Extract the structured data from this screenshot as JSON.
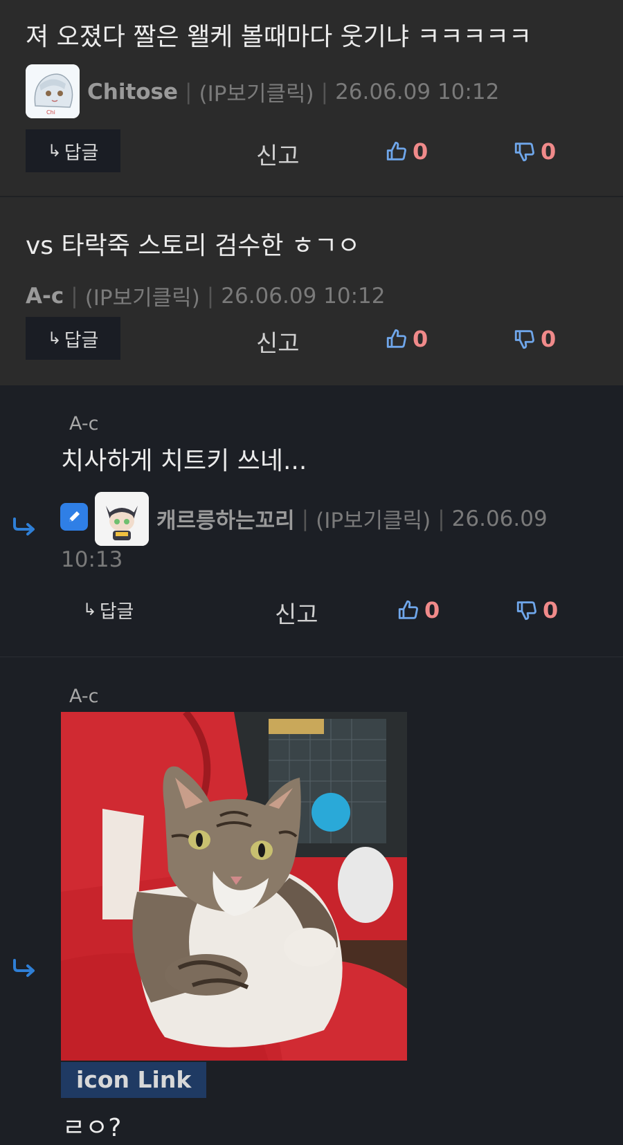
{
  "comments": [
    {
      "text": "져 오졌다 짤은 왤케 볼때마다 웃기냐 ㅋㅋㅋㅋㅋ",
      "author": "Chitose",
      "ip": "(IP보기클릭)",
      "date": "26.06.09 10:12",
      "reply_label": "답글",
      "report_label": "신고",
      "likes": "0",
      "dislikes": "0"
    },
    {
      "text": "vs 타락죽 스토리 검수한 ㅎㄱㅇ",
      "author": "A-c",
      "ip": "(IP보기클릭)",
      "date": "26.06.09 10:12",
      "reply_label": "답글",
      "report_label": "신고",
      "likes": "0",
      "dislikes": "0"
    },
    {
      "reply_to": "A-c",
      "text": "치사하게 치트키 쓰네...",
      "author": "캐르릉하는꼬리",
      "ip": "(IP보기클릭)",
      "date_part1": "26.06.09",
      "date_part2": "10:13",
      "reply_label": "답글",
      "report_label": "신고",
      "likes": "0",
      "dislikes": "0"
    },
    {
      "reply_to": "A-c",
      "link_label": "icon Link",
      "text": "ㄹㅇ?"
    }
  ],
  "colors": {
    "accent_blue": "#2f7fd6",
    "vote_count": "#f08a8a",
    "thumb_icon": "#6fa6ea"
  }
}
